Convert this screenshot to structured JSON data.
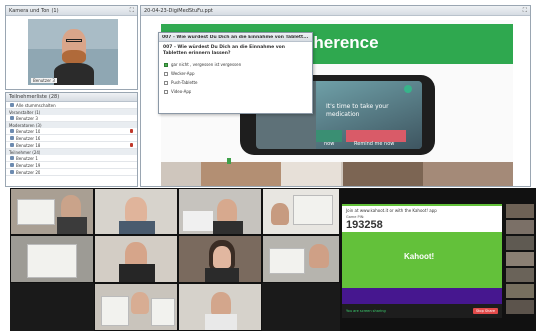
{
  "left_panel": {
    "camera_title": "Kamera und Ton",
    "camera_count": "(1)",
    "presenter_label": "Benutzer 3",
    "attendee_title": "Teilnehmerliste",
    "attendee_count": "(28)",
    "mute_label": "Alle stummschalten",
    "sections": [
      {
        "title": "Veranstalter (1)",
        "rows": [
          "Benutzer 3"
        ]
      },
      {
        "title": "Moderatoren (3)",
        "rows": [
          "Benutzer 10",
          "Benutzer 16",
          "Benutzer 18"
        ]
      },
      {
        "title": "Teilnehmer (24)",
        "rows": [
          "Benutzer 1",
          "Benutzer 19",
          "Benutzer 20"
        ]
      }
    ]
  },
  "slide_window": {
    "title": "20-04-23-DigiMedStuFu.ppt",
    "slide_heading": "dherence",
    "phone_notification": "It's time to take your medication",
    "phone_btn_left": "now",
    "phone_btn_right": "Remind me now"
  },
  "poll": {
    "header": "007 - Wie würdest Du Dich an die Einnahme von Tablett...",
    "question": "007 - Wie würdest Du Dich an die Einnahme von Tabletten erinnern lassen?",
    "options": [
      {
        "label": "gar nicht , vergessen ist vergessen",
        "checked": true
      },
      {
        "label": "Wecker-App",
        "checked": false
      },
      {
        "label": "Push-Tablette",
        "checked": false
      },
      {
        "label": "Video-App",
        "checked": false
      }
    ]
  },
  "kahoot": {
    "join_text": "Join at www.kahoot.it or with the Kahoot! app",
    "pin_label": "Game PIN:",
    "pin": "193258",
    "logo": "Kahoot!",
    "bar_text": "You are screen sharing",
    "stop_label": "Stop Share"
  },
  "colors": {
    "slide_green": "#2fa84f",
    "kahoot_green": "#63c13a",
    "kahoot_purple": "#46178f",
    "pin_text": "#333333"
  }
}
